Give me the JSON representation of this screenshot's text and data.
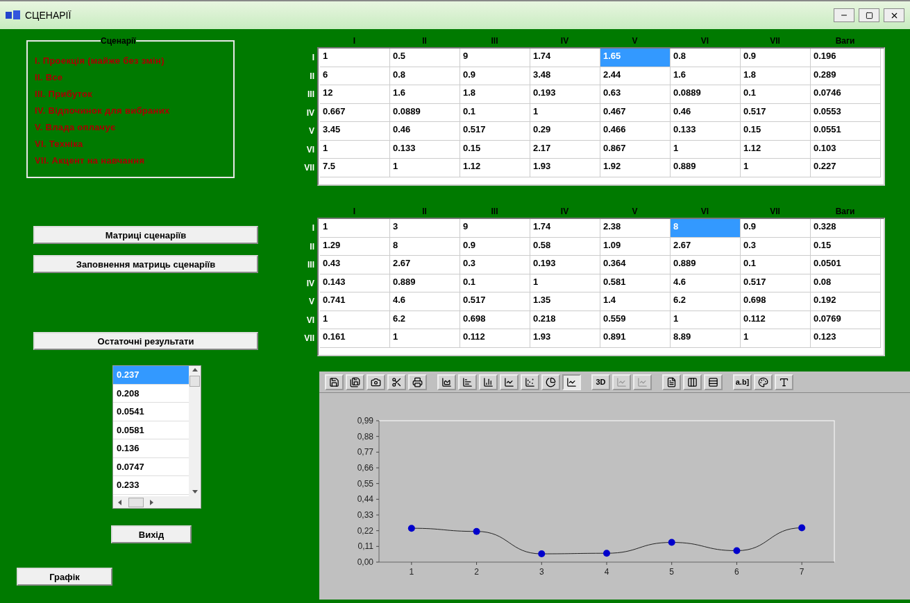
{
  "window": {
    "title": "СЦЕНАРІЇ"
  },
  "scenarios": {
    "title": "Сценарії",
    "items": [
      "I. Проекція (майже без змін)",
      "II. Все",
      "III. Прибуток",
      "IV. Відпочинок для вибраних",
      "V. Влада оплачує",
      "VI. Техніка",
      "VII. Акцент на навчання"
    ]
  },
  "buttons_top": [
    "Матриці сценаріїв",
    "Заповнення матриць сценаріїв"
  ],
  "results_button": "Остаточні результати",
  "results_list": [
    {
      "text": "0.237",
      "selected": true
    },
    {
      "text": "0.208",
      "selected": false
    },
    {
      "text": "0.0541",
      "selected": false
    },
    {
      "text": "0.0581",
      "selected": false
    },
    {
      "text": "0.136",
      "selected": false
    },
    {
      "text": "0.0747",
      "selected": false
    },
    {
      "text": "0.233",
      "selected": false
    }
  ],
  "exit_button": "Вихід",
  "graph_button": "Графік",
  "matrices": [
    {
      "columns": [
        "I",
        "II",
        "III",
        "IV",
        "V",
        "VI",
        "VII",
        "Ваги"
      ],
      "rows": [
        {
          "label": "I",
          "cells": [
            {
              "v": "1",
              "selected": false
            },
            {
              "v": "0.5",
              "selected": false
            },
            {
              "v": "9",
              "selected": false
            },
            {
              "v": "1.74",
              "selected": false
            },
            {
              "v": "1.65",
              "selected": true
            },
            {
              "v": "0.8",
              "selected": false
            },
            {
              "v": "0.9",
              "selected": false
            },
            {
              "v": "0.196",
              "selected": false
            }
          ]
        },
        {
          "label": "II",
          "cells": [
            {
              "v": "6",
              "selected": false
            },
            {
              "v": "0.8",
              "selected": false
            },
            {
              "v": "0.9",
              "selected": false
            },
            {
              "v": "3.48",
              "selected": false
            },
            {
              "v": "2.44",
              "selected": false
            },
            {
              "v": "1.6",
              "selected": false
            },
            {
              "v": "1.8",
              "selected": false
            },
            {
              "v": "0.289",
              "selected": false
            }
          ]
        },
        {
          "label": "III",
          "cells": [
            {
              "v": "12",
              "selected": false
            },
            {
              "v": "1.6",
              "selected": false
            },
            {
              "v": "1.8",
              "selected": false
            },
            {
              "v": "0.193",
              "selected": false
            },
            {
              "v": "0.63",
              "selected": false
            },
            {
              "v": "0.0889",
              "selected": false
            },
            {
              "v": "0.1",
              "selected": false
            },
            {
              "v": "0.0746",
              "selected": false
            }
          ]
        },
        {
          "label": "IV",
          "cells": [
            {
              "v": "0.667",
              "selected": false
            },
            {
              "v": "0.0889",
              "selected": false
            },
            {
              "v": "0.1",
              "selected": false
            },
            {
              "v": "1",
              "selected": false
            },
            {
              "v": "0.467",
              "selected": false
            },
            {
              "v": "0.46",
              "selected": false
            },
            {
              "v": "0.517",
              "selected": false
            },
            {
              "v": "0.0553",
              "selected": false
            }
          ]
        },
        {
          "label": "V",
          "cells": [
            {
              "v": "3.45",
              "selected": false
            },
            {
              "v": "0.46",
              "selected": false
            },
            {
              "v": "0.517",
              "selected": false
            },
            {
              "v": "0.29",
              "selected": false
            },
            {
              "v": "0.466",
              "selected": false
            },
            {
              "v": "0.133",
              "selected": false
            },
            {
              "v": "0.15",
              "selected": false
            },
            {
              "v": "0.0551",
              "selected": false
            }
          ]
        },
        {
          "label": "VI",
          "cells": [
            {
              "v": "1",
              "selected": false
            },
            {
              "v": "0.133",
              "selected": false
            },
            {
              "v": "0.15",
              "selected": false
            },
            {
              "v": "2.17",
              "selected": false
            },
            {
              "v": "0.867",
              "selected": false
            },
            {
              "v": "1",
              "selected": false
            },
            {
              "v": "1.12",
              "selected": false
            },
            {
              "v": "0.103",
              "selected": false
            }
          ]
        },
        {
          "label": "VII",
          "cells": [
            {
              "v": "7.5",
              "selected": false
            },
            {
              "v": "1",
              "selected": false
            },
            {
              "v": "1.12",
              "selected": false
            },
            {
              "v": "1.93",
              "selected": false
            },
            {
              "v": "1.92",
              "selected": false
            },
            {
              "v": "0.889",
              "selected": false
            },
            {
              "v": "1",
              "selected": false
            },
            {
              "v": "0.227",
              "selected": false
            }
          ]
        }
      ]
    },
    {
      "columns": [
        "I",
        "II",
        "III",
        "IV",
        "V",
        "VI",
        "VII",
        "Ваги"
      ],
      "rows": [
        {
          "label": "I",
          "cells": [
            {
              "v": "1",
              "selected": false
            },
            {
              "v": "3",
              "selected": false
            },
            {
              "v": "9",
              "selected": false
            },
            {
              "v": "1.74",
              "selected": false
            },
            {
              "v": "2.38",
              "selected": false
            },
            {
              "v": "8",
              "selected": true
            },
            {
              "v": "0.9",
              "selected": false
            },
            {
              "v": "0.328",
              "selected": false
            }
          ]
        },
        {
          "label": "II",
          "cells": [
            {
              "v": "1.29",
              "selected": false
            },
            {
              "v": "8",
              "selected": false
            },
            {
              "v": "0.9",
              "selected": false
            },
            {
              "v": "0.58",
              "selected": false
            },
            {
              "v": "1.09",
              "selected": false
            },
            {
              "v": "2.67",
              "selected": false
            },
            {
              "v": "0.3",
              "selected": false
            },
            {
              "v": "0.15",
              "selected": false
            }
          ]
        },
        {
          "label": "III",
          "cells": [
            {
              "v": "0.43",
              "selected": false
            },
            {
              "v": "2.67",
              "selected": false
            },
            {
              "v": "0.3",
              "selected": false
            },
            {
              "v": "0.193",
              "selected": false
            },
            {
              "v": "0.364",
              "selected": false
            },
            {
              "v": "0.889",
              "selected": false
            },
            {
              "v": "0.1",
              "selected": false
            },
            {
              "v": "0.0501",
              "selected": false
            }
          ]
        },
        {
          "label": "IV",
          "cells": [
            {
              "v": "0.143",
              "selected": false
            },
            {
              "v": "0.889",
              "selected": false
            },
            {
              "v": "0.1",
              "selected": false
            },
            {
              "v": "1",
              "selected": false
            },
            {
              "v": "0.581",
              "selected": false
            },
            {
              "v": "4.6",
              "selected": false
            },
            {
              "v": "0.517",
              "selected": false
            },
            {
              "v": "0.08",
              "selected": false
            }
          ]
        },
        {
          "label": "V",
          "cells": [
            {
              "v": "0.741",
              "selected": false
            },
            {
              "v": "4.6",
              "selected": false
            },
            {
              "v": "0.517",
              "selected": false
            },
            {
              "v": "1.35",
              "selected": false
            },
            {
              "v": "1.4",
              "selected": false
            },
            {
              "v": "6.2",
              "selected": false
            },
            {
              "v": "0.698",
              "selected": false
            },
            {
              "v": "0.192",
              "selected": false
            }
          ]
        },
        {
          "label": "VI",
          "cells": [
            {
              "v": "1",
              "selected": false
            },
            {
              "v": "6.2",
              "selected": false
            },
            {
              "v": "0.698",
              "selected": false
            },
            {
              "v": "0.218",
              "selected": false
            },
            {
              "v": "0.559",
              "selected": false
            },
            {
              "v": "1",
              "selected": false
            },
            {
              "v": "0.112",
              "selected": false
            },
            {
              "v": "0.0769",
              "selected": false
            }
          ]
        },
        {
          "label": "VII",
          "cells": [
            {
              "v": "0.161",
              "selected": false
            },
            {
              "v": "1",
              "selected": false
            },
            {
              "v": "0.112",
              "selected": false
            },
            {
              "v": "1.93",
              "selected": false
            },
            {
              "v": "0.891",
              "selected": false
            },
            {
              "v": "8.89",
              "selected": false
            },
            {
              "v": "1",
              "selected": false
            },
            {
              "v": "0.123",
              "selected": false
            }
          ]
        }
      ]
    }
  ],
  "toolbar": [
    [
      {
        "kind": "icon",
        "pressed": false,
        "disabled": false
      },
      {
        "kind": "icon",
        "pressed": false,
        "disabled": false
      },
      {
        "kind": "icon",
        "pressed": false,
        "disabled": false
      },
      {
        "kind": "icon",
        "pressed": false,
        "disabled": false
      },
      {
        "kind": "icon",
        "pressed": false,
        "disabled": false
      }
    ],
    [
      {
        "kind": "icon",
        "pressed": false,
        "disabled": false
      },
      {
        "kind": "icon",
        "pressed": false,
        "disabled": false
      },
      {
        "kind": "icon",
        "pressed": false,
        "disabled": false
      },
      {
        "kind": "icon",
        "pressed": false,
        "disabled": false
      },
      {
        "kind": "icon",
        "pressed": false,
        "disabled": false
      },
      {
        "kind": "icon",
        "pressed": false,
        "disabled": false
      },
      {
        "kind": "icon",
        "pressed": true,
        "disabled": false
      }
    ],
    [
      {
        "kind": "text",
        "text": "3D",
        "pressed": false,
        "disabled": false
      },
      {
        "kind": "icon",
        "pressed": false,
        "disabled": true
      },
      {
        "kind": "icon",
        "pressed": false,
        "disabled": true
      }
    ],
    [
      {
        "kind": "icon",
        "pressed": false,
        "disabled": false
      },
      {
        "kind": "icon",
        "pressed": false,
        "disabled": false
      },
      {
        "kind": "icon",
        "pressed": false,
        "disabled": false
      }
    ],
    [
      {
        "kind": "text",
        "text": "a.b]",
        "pressed": false,
        "disabled": false
      },
      {
        "kind": "icon",
        "pressed": false,
        "disabled": false
      },
      {
        "kind": "icon",
        "pressed": false,
        "disabled": false
      }
    ]
  ],
  "chart": {
    "chart_data": {
      "type": "line",
      "categories": [
        "1",
        "2",
        "3",
        "4",
        "5",
        "6",
        "7"
      ],
      "series": [
        {
          "color": "#0000cc",
          "marker": true,
          "values": [
            0.237,
            0.215,
            0.058,
            0.062,
            0.138,
            0.08,
            0.24
          ]
        }
      ],
      "ylim": [
        0,
        0.99
      ],
      "yticks": [
        {
          "value": 0,
          "label": "0,00"
        },
        {
          "value": 0.11,
          "label": "0,11"
        },
        {
          "value": 0.22,
          "label": "0,22"
        },
        {
          "value": 0.33,
          "label": "0,33"
        },
        {
          "value": 0.44,
          "label": "0,44"
        },
        {
          "value": 0.55,
          "label": "0,55"
        },
        {
          "value": 0.66,
          "label": "0,66"
        },
        {
          "value": 0.77,
          "label": "0,77"
        },
        {
          "value": 0.88,
          "label": "0,88"
        },
        {
          "value": 0.99,
          "label": "0,99"
        }
      ]
    }
  }
}
